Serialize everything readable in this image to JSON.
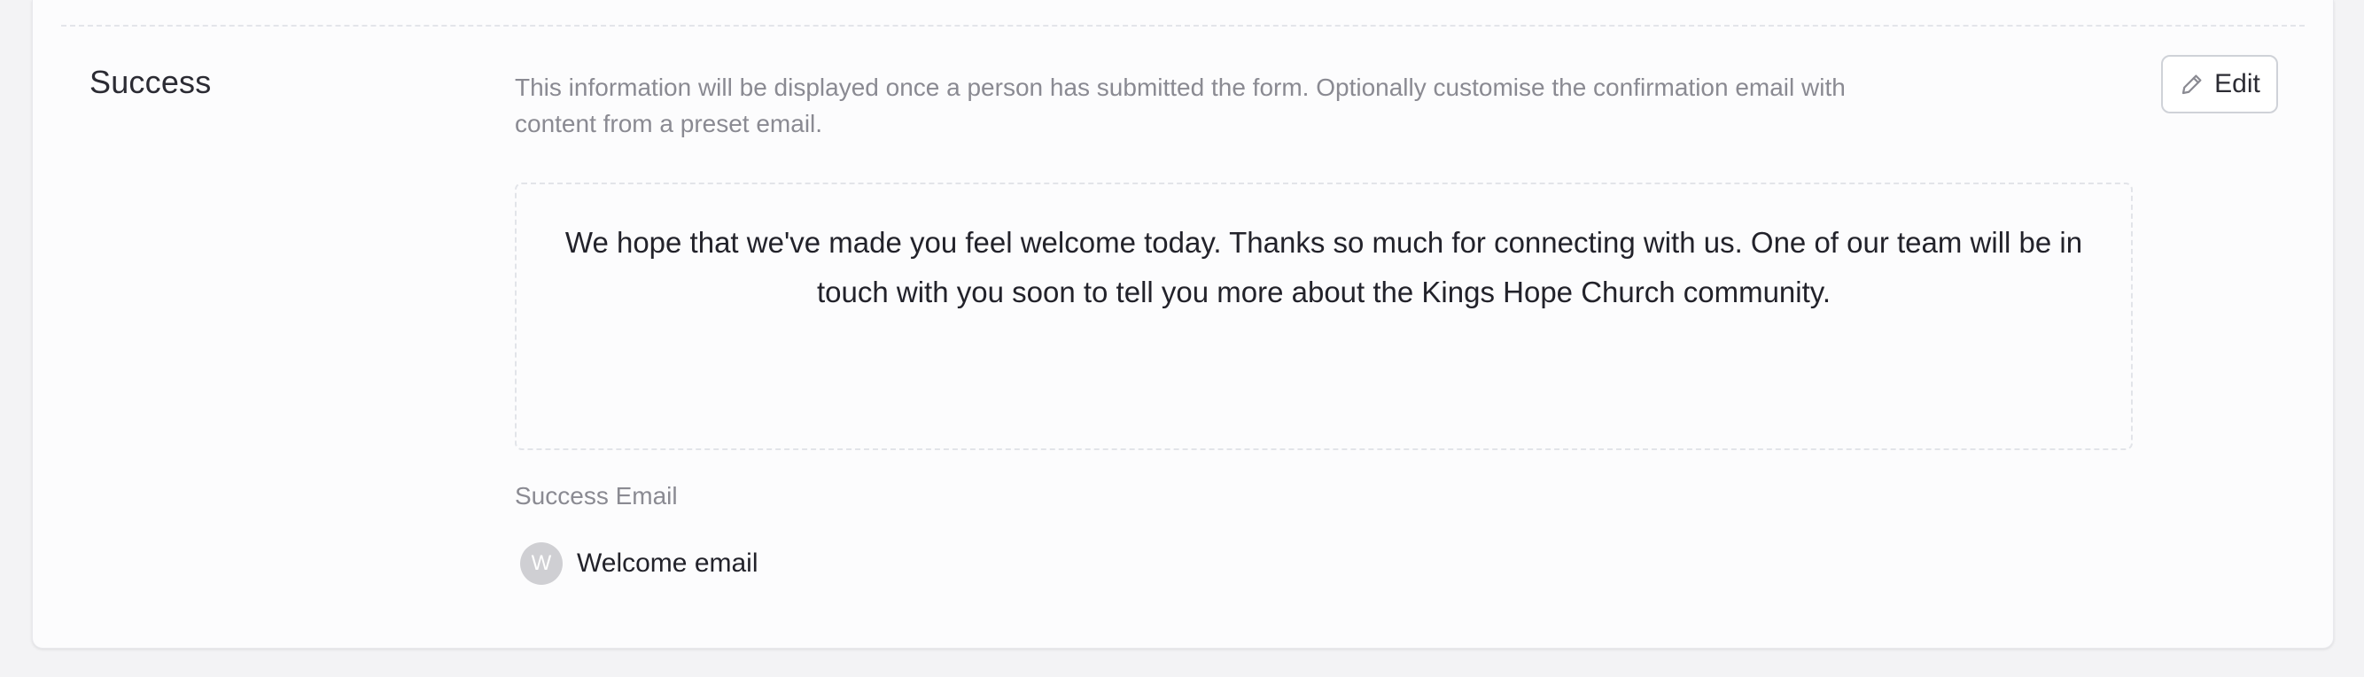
{
  "section": {
    "title": "Success",
    "description": "This information will be displayed once a person has submitted the form. Optionally customise the confirmation email with content from a preset email.",
    "edit_label": "Edit",
    "message": "We hope that we've made you feel welcome today. Thanks so much for connecting with us. One of our team will be in touch with you soon to tell you more about the Kings Hope Church community."
  },
  "success_email": {
    "label": "Success Email",
    "avatar_initial": "W",
    "name": "Welcome email"
  },
  "icons": {
    "edit": "pencil-icon"
  },
  "colors": {
    "background": "#f3f3f5",
    "card": "#fcfcfd",
    "text_primary": "#22222a",
    "text_muted": "#8a8a92",
    "avatar": "#cfcfd3"
  }
}
